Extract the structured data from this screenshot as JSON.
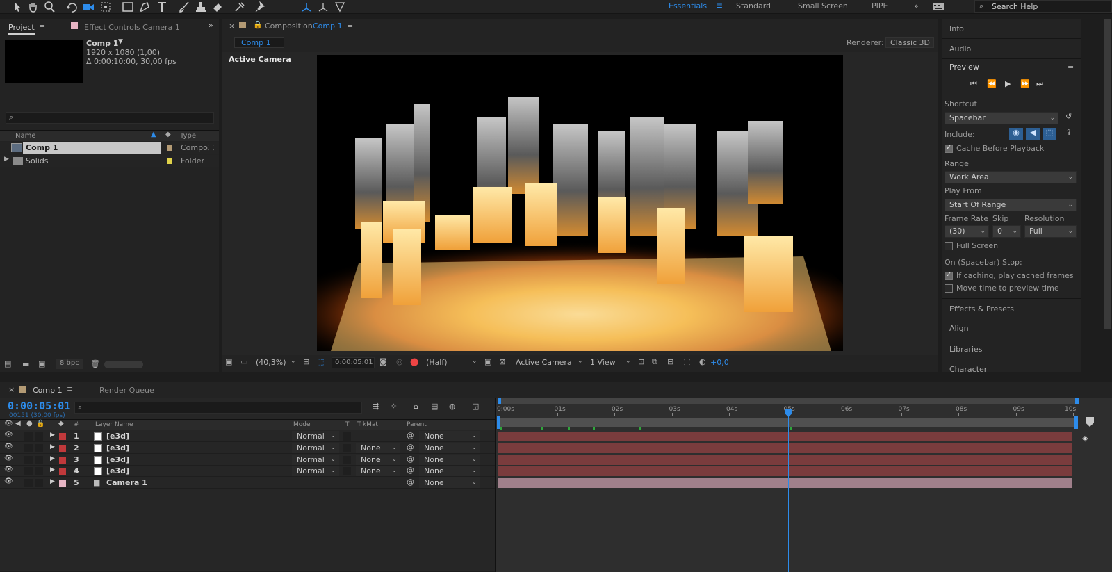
{
  "toolbar": {
    "workspaces": [
      "Essentials",
      "Standard",
      "Small Screen",
      "PIPE"
    ],
    "active_workspace": "Essentials",
    "search_placeholder": "Search Help",
    "more": "»"
  },
  "project": {
    "tab_label": "Project",
    "effect_controls_label": "Effect Controls Camera 1",
    "comp_name": "Comp 1",
    "comp_size": "1920 x 1080 (1,00)",
    "comp_duration": "Δ 0:00:10:00, 30,00 fps",
    "col_name": "Name",
    "col_type": "Type",
    "items": [
      {
        "name": "Comp 1",
        "type": "Compo",
        "label_color": "#b39a74"
      },
      {
        "name": "Solids",
        "type": "Folder",
        "label_color": "#e0d24a"
      }
    ],
    "bpc": "8 bpc"
  },
  "composition": {
    "header_prefix": "Composition",
    "header_comp": "Comp 1",
    "tab": "Comp 1",
    "renderer_label": "Renderer:",
    "renderer_value": "Classic 3D",
    "view_label": "Active Camera",
    "zoom": "(40,3%)",
    "timecode": "0:00:05:01",
    "resolution": "(Half)",
    "camera": "Active Camera",
    "views": "1 View",
    "exposure": "+0,0"
  },
  "right_panel": {
    "info": "Info",
    "audio": "Audio",
    "preview": "Preview",
    "shortcut_label": "Shortcut",
    "shortcut_value": "Spacebar",
    "include_label": "Include:",
    "cache_label": "Cache Before Playback",
    "range_label": "Range",
    "range_value": "Work Area",
    "play_from_label": "Play From",
    "play_from_value": "Start Of Range",
    "frame_rate_label": "Frame Rate",
    "frame_rate_value": "(30)",
    "skip_label": "Skip",
    "skip_value": "0",
    "resolution_label": "Resolution",
    "resolution_value": "Full",
    "full_screen_label": "Full Screen",
    "stop_label": "On (Spacebar) Stop:",
    "if_caching_label": "If caching, play cached frames",
    "move_time_label": "Move time to preview time",
    "effects_presets": "Effects & Presets",
    "align": "Align",
    "libraries": "Libraries",
    "character": "Character"
  },
  "timeline": {
    "tab": "Comp 1",
    "render_queue": "Render Queue",
    "timecode": "0:00:05:01",
    "frame_info": "00151 (30.00 fps)",
    "col_num": "#",
    "col_layer": "Layer Name",
    "col_mode": "Mode",
    "col_t": "T",
    "col_trkmat": "TrkMat",
    "col_parent": "Parent",
    "ruler": [
      "0:00s",
      "01s",
      "02s",
      "03s",
      "04s",
      "05s",
      "06s",
      "07s",
      "08s",
      "09s",
      "10s"
    ],
    "playhead_seconds": 5.03,
    "layers": [
      {
        "num": "1",
        "name": "[e3d]",
        "mode": "Normal",
        "trkmat": "",
        "parent": "None",
        "label_color": "#c0393b"
      },
      {
        "num": "2",
        "name": "[e3d]",
        "mode": "Normal",
        "trkmat": "None",
        "parent": "None",
        "label_color": "#c0393b"
      },
      {
        "num": "3",
        "name": "[e3d]",
        "mode": "Normal",
        "trkmat": "None",
        "parent": "None",
        "label_color": "#c0393b"
      },
      {
        "num": "4",
        "name": "[e3d]",
        "mode": "Normal",
        "trkmat": "None",
        "parent": "None",
        "label_color": "#c0393b"
      },
      {
        "num": "5",
        "name": "Camera 1",
        "mode": "",
        "trkmat": "",
        "parent": "None",
        "label_color": "#e7b5c4"
      }
    ]
  },
  "colors": {
    "accent_blue": "#2d8ceb",
    "layer_bar": "#7a3c3d",
    "camera_bar": "#a0808b"
  }
}
